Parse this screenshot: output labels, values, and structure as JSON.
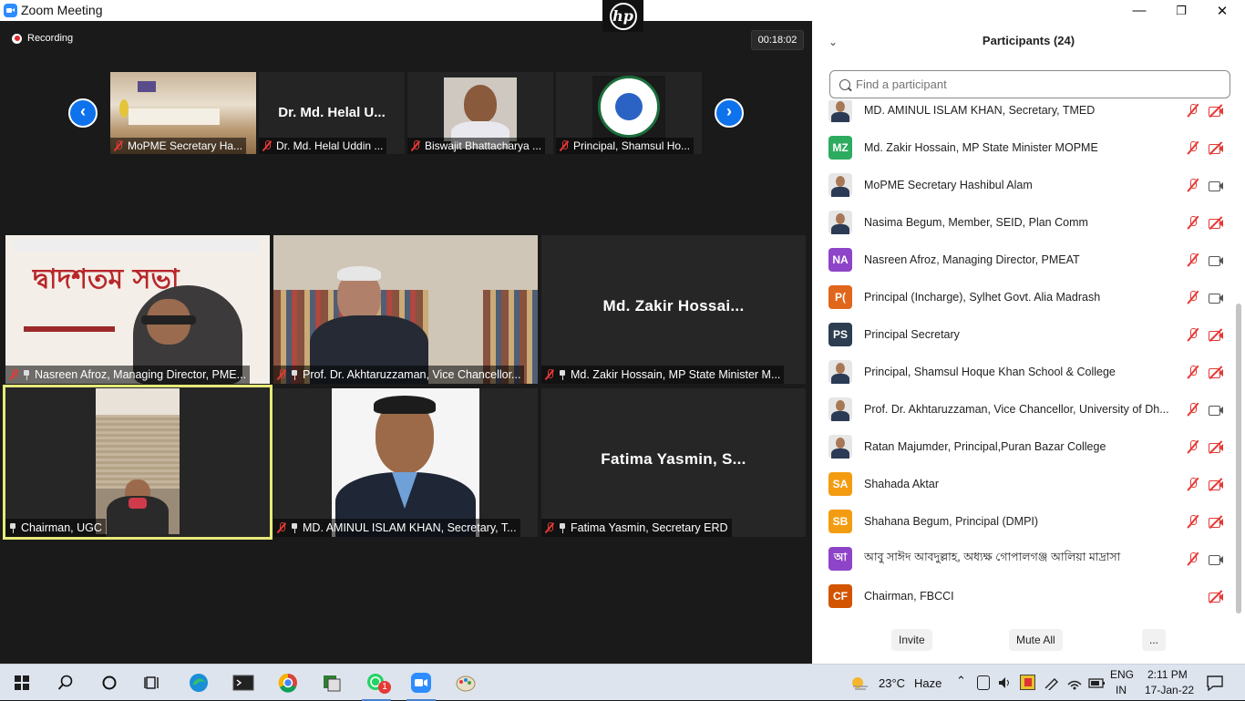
{
  "window": {
    "title": "Zoom Meeting",
    "minimize": "—",
    "maximize": "❐",
    "close": "✕"
  },
  "meeting": {
    "recording_label": "Recording",
    "timer": "00:18:02",
    "prev_arrow": "‹",
    "next_arrow": "›",
    "strip": [
      {
        "label": "MoPME Secretary Ha...",
        "center_text": ""
      },
      {
        "label": "Dr. Md. Helal Uddin ...",
        "center_text": "Dr. Md. Helal U..."
      },
      {
        "label": "Biswajit Bhattacharya ...",
        "center_text": ""
      },
      {
        "label": "Principal, Shamsul Ho...",
        "center_text": ""
      }
    ],
    "gallery": [
      {
        "label": "Nasreen Afroz, Managing Director, PME...",
        "center_text": "",
        "banner": "দ্বাদশতম সভা"
      },
      {
        "label": "Prof. Dr. Akhtaruzzaman, Vice Chancellor...",
        "center_text": ""
      },
      {
        "label": "Md. Zakir Hossain, MP State Minister M...",
        "center_text": "Md. Zakir Hossai..."
      },
      {
        "label": "Chairman, UGC",
        "center_text": ""
      },
      {
        "label": "MD. AMINUL ISLAM KHAN, Secretary, T...",
        "center_text": ""
      },
      {
        "label": "Fatima Yasmin, Secretary ERD",
        "center_text": "Fatima Yasmin, S..."
      }
    ],
    "active_speaker_color": "#e6ea7a"
  },
  "participants": {
    "title": "Participants (24)",
    "search_placeholder": "Find a participant",
    "list": [
      {
        "name": "MD. AMINUL ISLAM KHAN, Secretary, TMED",
        "avatar_type": "photo",
        "initials": "",
        "color": "",
        "mic": "muted",
        "cam": "off"
      },
      {
        "name": "Md. Zakir Hossain, MP State Minister MOPME",
        "avatar_type": "initials",
        "initials": "MZ",
        "color": "#2dab5f",
        "mic": "muted",
        "cam": "off"
      },
      {
        "name": "MoPME Secretary Hashibul Alam",
        "avatar_type": "photo",
        "initials": "",
        "color": "",
        "mic": "muted",
        "cam": "on"
      },
      {
        "name": "Nasima Begum, Member, SEID, Plan Comm",
        "avatar_type": "photo",
        "initials": "",
        "color": "",
        "mic": "muted",
        "cam": "off"
      },
      {
        "name": "Nasreen Afroz, Managing Director, PMEAT",
        "avatar_type": "initials",
        "initials": "NA",
        "color": "#8e44c8",
        "mic": "muted",
        "cam": "on"
      },
      {
        "name": "Principal (Incharge), Sylhet Govt. Alia Madrash",
        "avatar_type": "initials",
        "initials": "P(",
        "color": "#e0661b",
        "mic": "muted",
        "cam": "on"
      },
      {
        "name": "Principal Secretary",
        "avatar_type": "initials",
        "initials": "PS",
        "color": "#2c3e50",
        "mic": "muted",
        "cam": "off"
      },
      {
        "name": "Principal, Shamsul Hoque Khan School & College",
        "avatar_type": "photo",
        "initials": "",
        "color": "",
        "mic": "muted",
        "cam": "off"
      },
      {
        "name": "Prof. Dr. Akhtaruzzaman, Vice Chancellor, University of Dh...",
        "avatar_type": "photo",
        "initials": "",
        "color": "",
        "mic": "muted",
        "cam": "on"
      },
      {
        "name": "Ratan Majumder, Principal,Puran Bazar College",
        "avatar_type": "photo",
        "initials": "",
        "color": "",
        "mic": "muted",
        "cam": "off"
      },
      {
        "name": "Shahada Aktar",
        "avatar_type": "initials",
        "initials": "SA",
        "color": "#f39c12",
        "mic": "muted",
        "cam": "off"
      },
      {
        "name": "Shahana Begum,  Principal (DMPI)",
        "avatar_type": "initials",
        "initials": "SB",
        "color": "#f39c12",
        "mic": "muted",
        "cam": "off"
      },
      {
        "name": "আবু সাঈদ আবদুল্লাহ, অধ্যক্ষ গোপালগঞ্জ আলিয়া মাদ্রাসা",
        "avatar_type": "initials",
        "initials": "আ",
        "color": "#8e44c8",
        "mic": "muted",
        "cam": "on"
      },
      {
        "name": "Chairman, FBCCI",
        "avatar_type": "initials",
        "initials": "CF",
        "color": "#d35400",
        "mic": "none",
        "cam": "off"
      }
    ],
    "buttons": {
      "invite": "Invite",
      "mute_all": "Mute All",
      "more": "..."
    }
  },
  "taskbar": {
    "weather_temp": "23°C",
    "weather_desc": "Haze",
    "lang_top": "ENG",
    "lang_bottom": "IN",
    "time": "2:11 PM",
    "date": "17-Jan-22",
    "whatsapp_badge": "1"
  }
}
